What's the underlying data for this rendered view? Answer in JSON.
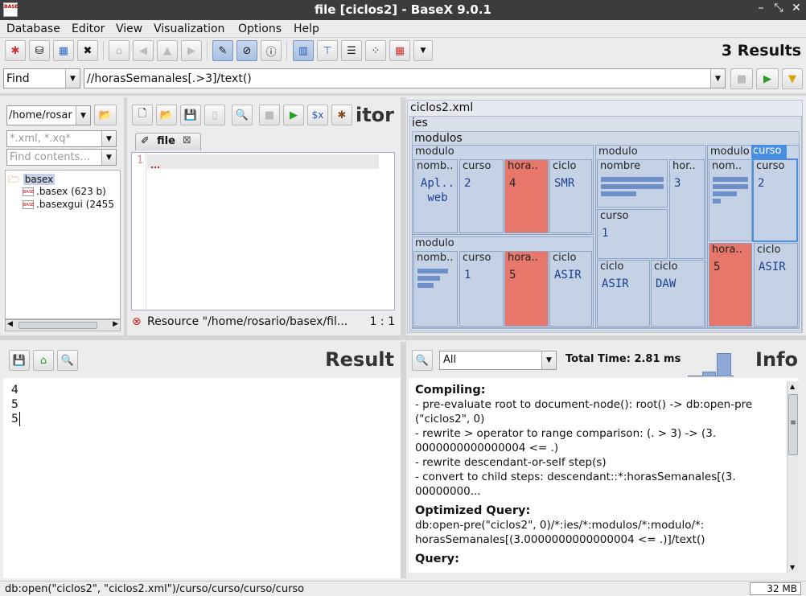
{
  "window": {
    "title": "file [ciclos2] - BaseX 9.0.1",
    "app_icon": "BASE",
    "controls": [
      "–",
      "⤡",
      "✕"
    ]
  },
  "menu": [
    "Database",
    "Editor",
    "View",
    "Visualization",
    "Options",
    "Help"
  ],
  "toolbar": {
    "result_count": "3 Results"
  },
  "query": {
    "mode": "Find",
    "text": "//horasSemanales[.>3]/text()"
  },
  "explorer": {
    "path": "/home/rosar",
    "filter_placeholder": "*.xml, *.xq*",
    "contents_placeholder": "Find contents...",
    "tree": {
      "root": "basex",
      "files": [
        ".basex (623 b)",
        ".basexgui (2455"
      ]
    }
  },
  "editor": {
    "title": "itor",
    "tab_label": "file",
    "line_number": "1",
    "status_message": "Resource \"/home/rosario/basex/fil...",
    "cursor_pos": "1 : 1",
    "xquery_button": "$x"
  },
  "map": {
    "file": "ciclos2.xml",
    "root": "ies",
    "container": "modulos",
    "labels": {
      "modulo": "modulo",
      "nombre": "nombre",
      "nomb_short": "nomb..",
      "nom_short": "nom..",
      "curso": "curso",
      "hora_short": "hora..",
      "hor_short": "hor..",
      "ciclo": "ciclo"
    },
    "values": {
      "m1_nombre": "Apl.. web",
      "m1_curso": "2",
      "m1_horas": "4",
      "m1_ciclo": "SMR",
      "m2_curso": "1",
      "m2_horas": "5",
      "m2_ciclo": "ASIR",
      "m3_horas": "3",
      "m3_curso": "1",
      "m3_ciclo_a": "ASIR",
      "m3_ciclo_b": "DAW",
      "m4_curso": "2",
      "m4_horas": "5",
      "m4_ciclo": "ASIR"
    }
  },
  "result": {
    "title": "Result",
    "lines": [
      "4",
      "5",
      "5"
    ]
  },
  "info": {
    "title": "Info",
    "filter": "All",
    "total_time": "Total Time: 2.81 ms",
    "sections": [
      {
        "heading": "Compiling:",
        "lines": [
          "- pre-evaluate root to document-node(): root() -> db:open-pre",
          "(\"ciclos2\", 0)",
          "- rewrite > operator to range comparison: (. > 3) -> (3.",
          "0000000000000004 <= .)",
          "- rewrite descendant-or-self step(s)",
          "- convert to child steps: descendant::*:horasSemanales[(3.",
          "00000000..."
        ]
      },
      {
        "heading": "Optimized Query:",
        "lines": [
          "db:open-pre(\"ciclos2\", 0)/*:ies/*:modulos/*:modulo/*:",
          "horasSemanales[(3.0000000000000004 <= .)]/text()"
        ]
      },
      {
        "heading": "Query:",
        "lines": []
      }
    ]
  },
  "status": {
    "path": "db:open(\"ciclos2\", \"ciclos2.xml\")/curso/curso/curso/curso",
    "memory": "32 MB"
  }
}
